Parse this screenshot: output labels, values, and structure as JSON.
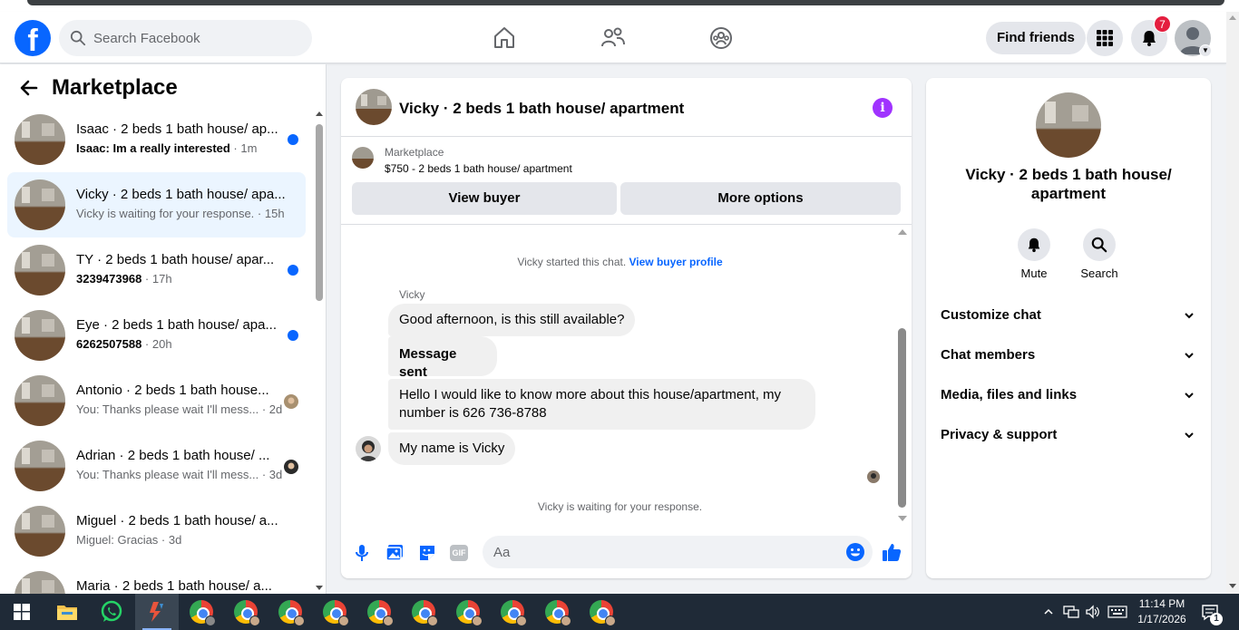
{
  "topnav": {
    "search_placeholder": "Search Facebook",
    "find_friends": "Find friends",
    "notification_count": "7"
  },
  "sidebar": {
    "title": "Marketplace",
    "conversations": [
      {
        "title": "Isaac · 2 beds 1 bath house/ ap...",
        "preview": "Isaac: Im a really interested",
        "time": "1m",
        "unread": true
      },
      {
        "title": "Vicky · 2 beds 1 bath house/ apa...",
        "preview": "Vicky is waiting for your response.",
        "time": "15h",
        "unread": false
      },
      {
        "title": "TY · 2 beds 1 bath house/ apar...",
        "preview": "3239473968",
        "time": "17h",
        "unread": true
      },
      {
        "title": "Eye · 2 beds 1 bath house/ apa...",
        "preview": "6262507588",
        "time": "20h",
        "unread": true
      },
      {
        "title": "Antonio · 2 beds 1 bath house...",
        "preview": "You: Thanks please wait I'll mess...",
        "time": "2d",
        "unread": false
      },
      {
        "title": "Adrian · 2 beds 1 bath house/ ...",
        "preview": "You: Thanks please wait I'll mess...",
        "time": "3d",
        "unread": false
      },
      {
        "title": "Miguel · 2 beds 1 bath house/ a...",
        "preview": "Miguel: Gracias",
        "time": "3d",
        "unread": false
      },
      {
        "title": "Maria · 2 beds 1 bath house/ a...",
        "preview": "",
        "time": "",
        "unread": false
      }
    ]
  },
  "chat": {
    "title": "Vicky · 2 beds 1 bath house/ apartment",
    "listing_source": "Marketplace",
    "listing_price": "$750 - 2 beds 1 bath house/ apartment",
    "view_buyer": "View buyer",
    "more_options": "More options",
    "started_text": "Vicky started this chat.",
    "view_buyer_profile": "View buyer profile",
    "sender_name": "Vicky",
    "messages": [
      "Good afternoon, is this still available?",
      "Message sent",
      "Hello I would like to know more about this house/apartment, my number is 626 736-8788",
      "My name is Vicky"
    ],
    "waiting_text": "Vicky is waiting for your response.",
    "input_placeholder": "Aa",
    "gif_label": "GIF"
  },
  "info_panel": {
    "name": "Vicky · 2 beds 1 bath house/ apartment",
    "mute": "Mute",
    "search": "Search",
    "sections": [
      "Customize chat",
      "Chat members",
      "Media, files and links",
      "Privacy & support"
    ]
  },
  "taskbar": {
    "time": "11:14 PM",
    "date": "1/17/2026",
    "notification_count": "1"
  },
  "colors": {
    "brand_blue": "#0866ff",
    "unread_dot": "#0866ff",
    "notification_red": "#e41e3f",
    "info_purple": "#a033ff",
    "taskbar": "#1f2a37"
  }
}
